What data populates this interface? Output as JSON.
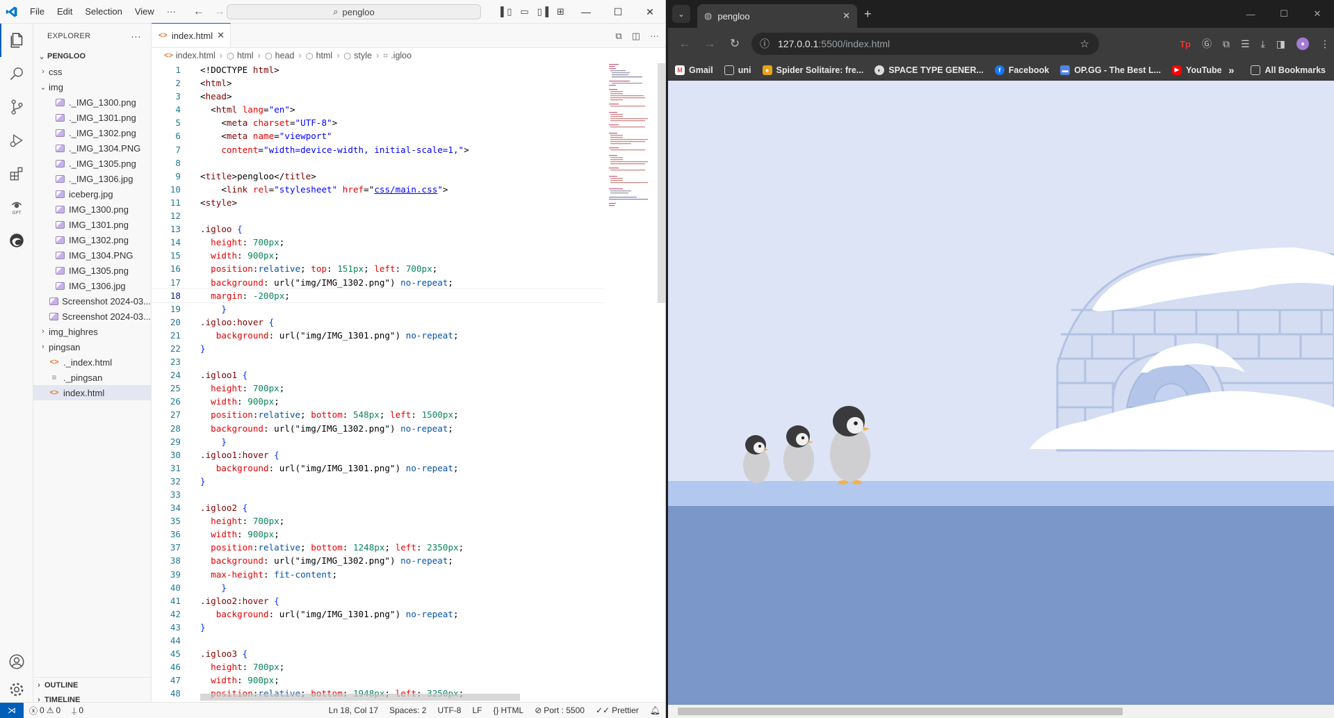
{
  "vscode": {
    "menu": [
      "File",
      "Edit",
      "Selection",
      "View",
      "···"
    ],
    "command_center": "pengloo",
    "explorer_title": "EXPLORER",
    "root_folder": "PENGLOO",
    "tree": [
      {
        "label": "css",
        "kind": "folder",
        "depth": 1,
        "open": false
      },
      {
        "label": "img",
        "kind": "folder",
        "depth": 1,
        "open": true
      },
      {
        "label": "._IMG_1300.png",
        "kind": "image",
        "depth": 2
      },
      {
        "label": "._IMG_1301.png",
        "kind": "image",
        "depth": 2
      },
      {
        "label": "._IMG_1302.png",
        "kind": "image",
        "depth": 2
      },
      {
        "label": "._IMG_1304.PNG",
        "kind": "image",
        "depth": 2
      },
      {
        "label": "._IMG_1305.png",
        "kind": "image",
        "depth": 2
      },
      {
        "label": "._IMG_1306.jpg",
        "kind": "image",
        "depth": 2
      },
      {
        "label": "iceberg.jpg",
        "kind": "image",
        "depth": 2
      },
      {
        "label": "IMG_1300.png",
        "kind": "image",
        "depth": 2
      },
      {
        "label": "IMG_1301.png",
        "kind": "image",
        "depth": 2
      },
      {
        "label": "IMG_1302.png",
        "kind": "image",
        "depth": 2
      },
      {
        "label": "IMG_1304.PNG",
        "kind": "image",
        "depth": 2
      },
      {
        "label": "IMG_1305.png",
        "kind": "image",
        "depth": 2
      },
      {
        "label": "IMG_1306.jpg",
        "kind": "image",
        "depth": 2
      },
      {
        "label": "Screenshot 2024-03...",
        "kind": "image",
        "depth": 2
      },
      {
        "label": "Screenshot 2024-03...",
        "kind": "image",
        "depth": 2
      },
      {
        "label": "img_highres",
        "kind": "folder",
        "depth": 1,
        "open": false
      },
      {
        "label": "pingsan",
        "kind": "folder",
        "depth": 1,
        "open": false
      },
      {
        "label": "._index.html",
        "kind": "html",
        "depth": 1
      },
      {
        "label": "._pingsan",
        "kind": "text",
        "depth": 1
      },
      {
        "label": "index.html",
        "kind": "html",
        "depth": 1,
        "selected": true
      }
    ],
    "outline_label": "OUTLINE",
    "timeline_label": "TIMELINE",
    "tab_label": "index.html",
    "breadcrumb": [
      "index.html",
      "html",
      "head",
      "html",
      "style",
      ".igloo"
    ],
    "current_line": 18,
    "code_lines": [
      [
        [
          "t-plain",
          "<!DOCTYPE "
        ],
        [
          "t-tag",
          "html"
        ],
        [
          "t-plain",
          ">"
        ]
      ],
      [
        [
          "t-plain",
          "<"
        ],
        [
          "t-tag",
          "html"
        ],
        [
          "t-plain",
          ">"
        ]
      ],
      [
        [
          "t-plain",
          "<"
        ],
        [
          "t-tag",
          "head"
        ],
        [
          "t-plain",
          ">"
        ]
      ],
      [
        [
          "t-plain",
          "  <"
        ],
        [
          "t-tag",
          "html"
        ],
        [
          "t-plain",
          " "
        ],
        [
          "t-attr",
          "lang"
        ],
        [
          "t-plain",
          "="
        ],
        [
          "t-str",
          "\"en\""
        ],
        [
          "t-plain",
          ">"
        ]
      ],
      [
        [
          "t-plain",
          "    <"
        ],
        [
          "t-tag",
          "meta"
        ],
        [
          "t-plain",
          " "
        ],
        [
          "t-attr",
          "charset"
        ],
        [
          "t-plain",
          "="
        ],
        [
          "t-str",
          "\"UTF-8\""
        ],
        [
          "t-plain",
          ">"
        ]
      ],
      [
        [
          "t-plain",
          "    <"
        ],
        [
          "t-tag",
          "meta"
        ],
        [
          "t-plain",
          " "
        ],
        [
          "t-attr",
          "name"
        ],
        [
          "t-plain",
          "="
        ],
        [
          "t-str",
          "\"viewport\""
        ]
      ],
      [
        [
          "t-plain",
          "    "
        ],
        [
          "t-attr",
          "content"
        ],
        [
          "t-plain",
          "="
        ],
        [
          "t-str",
          "\"width=device-width, initial-scale=1,\""
        ],
        [
          "t-plain",
          ">"
        ]
      ],
      [
        [
          "t-plain",
          ""
        ]
      ],
      [
        [
          "t-plain",
          "<"
        ],
        [
          "t-tag",
          "title"
        ],
        [
          "t-plain",
          ">pengloo</"
        ],
        [
          "t-tag",
          "title"
        ],
        [
          "t-plain",
          ">"
        ]
      ],
      [
        [
          "t-plain",
          "    <"
        ],
        [
          "t-tag",
          "link"
        ],
        [
          "t-plain",
          " "
        ],
        [
          "t-attr",
          "rel"
        ],
        [
          "t-plain",
          "="
        ],
        [
          "t-str",
          "\"stylesheet\""
        ],
        [
          "t-plain",
          " "
        ],
        [
          "t-attr",
          "href"
        ],
        [
          "t-plain",
          "=\""
        ],
        [
          "t-link",
          "css/main.css"
        ],
        [
          "t-str",
          "\""
        ],
        [
          "t-plain",
          ">"
        ]
      ],
      [
        [
          "t-plain",
          "<"
        ],
        [
          "t-tag",
          "style"
        ],
        [
          "t-plain",
          ">"
        ]
      ],
      [
        [
          "t-plain",
          ""
        ]
      ],
      [
        [
          "t-sel",
          ".igloo"
        ],
        [
          "t-plain",
          " "
        ],
        [
          "t-brace",
          "{"
        ]
      ],
      [
        [
          "t-plain",
          "  "
        ],
        [
          "t-prop",
          "height"
        ],
        [
          "t-plain",
          ": "
        ],
        [
          "t-num",
          "700px"
        ],
        [
          "t-plain",
          ";"
        ]
      ],
      [
        [
          "t-plain",
          "  "
        ],
        [
          "t-prop",
          "width"
        ],
        [
          "t-plain",
          ": "
        ],
        [
          "t-num",
          "900px"
        ],
        [
          "t-plain",
          ";"
        ]
      ],
      [
        [
          "t-plain",
          "  "
        ],
        [
          "t-prop",
          "position"
        ],
        [
          "t-plain",
          ":"
        ],
        [
          "t-val",
          "relative"
        ],
        [
          "t-plain",
          "; "
        ],
        [
          "t-prop",
          "top"
        ],
        [
          "t-plain",
          ": "
        ],
        [
          "t-num",
          "151px"
        ],
        [
          "t-plain",
          "; "
        ],
        [
          "t-prop",
          "left"
        ],
        [
          "t-plain",
          ": "
        ],
        [
          "t-num",
          "700px"
        ],
        [
          "t-plain",
          ";"
        ]
      ],
      [
        [
          "t-plain",
          "  "
        ],
        [
          "t-prop",
          "background"
        ],
        [
          "t-plain",
          ": url("
        ],
        [
          "t-plain",
          "\"img/IMG_1302.png\""
        ],
        [
          "t-plain",
          ") "
        ],
        [
          "t-val",
          "no-repeat"
        ],
        [
          "t-plain",
          ";"
        ]
      ],
      [
        [
          "t-plain",
          "  "
        ],
        [
          "t-prop",
          "margin"
        ],
        [
          "t-plain",
          ": "
        ],
        [
          "t-num",
          "-200px"
        ],
        [
          "t-plain",
          ";"
        ]
      ],
      [
        [
          "t-plain",
          "    "
        ],
        [
          "t-brace",
          "}"
        ]
      ],
      [
        [
          "t-sel",
          ".igloo:hover"
        ],
        [
          "t-plain",
          " "
        ],
        [
          "t-brace",
          "{"
        ]
      ],
      [
        [
          "t-plain",
          "   "
        ],
        [
          "t-prop",
          "background"
        ],
        [
          "t-plain",
          ": url("
        ],
        [
          "t-plain",
          "\"img/IMG_1301.png\""
        ],
        [
          "t-plain",
          ") "
        ],
        [
          "t-val",
          "no-repeat"
        ],
        [
          "t-plain",
          ";"
        ]
      ],
      [
        [
          "t-brace",
          "}"
        ]
      ],
      [
        [
          "t-plain",
          ""
        ]
      ],
      [
        [
          "t-sel",
          ".igloo1"
        ],
        [
          "t-plain",
          " "
        ],
        [
          "t-brace",
          "{"
        ]
      ],
      [
        [
          "t-plain",
          "  "
        ],
        [
          "t-prop",
          "height"
        ],
        [
          "t-plain",
          ": "
        ],
        [
          "t-num",
          "700px"
        ],
        [
          "t-plain",
          ";"
        ]
      ],
      [
        [
          "t-plain",
          "  "
        ],
        [
          "t-prop",
          "width"
        ],
        [
          "t-plain",
          ": "
        ],
        [
          "t-num",
          "900px"
        ],
        [
          "t-plain",
          ";"
        ]
      ],
      [
        [
          "t-plain",
          "  "
        ],
        [
          "t-prop",
          "position"
        ],
        [
          "t-plain",
          ":"
        ],
        [
          "t-val",
          "relative"
        ],
        [
          "t-plain",
          "; "
        ],
        [
          "t-prop",
          "bottom"
        ],
        [
          "t-plain",
          ": "
        ],
        [
          "t-num",
          "548px"
        ],
        [
          "t-plain",
          "; "
        ],
        [
          "t-prop",
          "left"
        ],
        [
          "t-plain",
          ": "
        ],
        [
          "t-num",
          "1500px"
        ],
        [
          "t-plain",
          ";"
        ]
      ],
      [
        [
          "t-plain",
          "  "
        ],
        [
          "t-prop",
          "background"
        ],
        [
          "t-plain",
          ": url("
        ],
        [
          "t-plain",
          "\"img/IMG_1302.png\""
        ],
        [
          "t-plain",
          ") "
        ],
        [
          "t-val",
          "no-repeat"
        ],
        [
          "t-plain",
          ";"
        ]
      ],
      [
        [
          "t-plain",
          "    "
        ],
        [
          "t-brace",
          "}"
        ]
      ],
      [
        [
          "t-sel",
          ".igloo1:hover"
        ],
        [
          "t-plain",
          " "
        ],
        [
          "t-brace",
          "{"
        ]
      ],
      [
        [
          "t-plain",
          "   "
        ],
        [
          "t-prop",
          "background"
        ],
        [
          "t-plain",
          ": url("
        ],
        [
          "t-plain",
          "\"img/IMG_1301.png\""
        ],
        [
          "t-plain",
          ") "
        ],
        [
          "t-val",
          "no-repeat"
        ],
        [
          "t-plain",
          ";"
        ]
      ],
      [
        [
          "t-brace",
          "}"
        ]
      ],
      [
        [
          "t-plain",
          ""
        ]
      ],
      [
        [
          "t-sel",
          ".igloo2"
        ],
        [
          "t-plain",
          " "
        ],
        [
          "t-brace",
          "{"
        ]
      ],
      [
        [
          "t-plain",
          "  "
        ],
        [
          "t-prop",
          "height"
        ],
        [
          "t-plain",
          ": "
        ],
        [
          "t-num",
          "700px"
        ],
        [
          "t-plain",
          ";"
        ]
      ],
      [
        [
          "t-plain",
          "  "
        ],
        [
          "t-prop",
          "width"
        ],
        [
          "t-plain",
          ": "
        ],
        [
          "t-num",
          "900px"
        ],
        [
          "t-plain",
          ";"
        ]
      ],
      [
        [
          "t-plain",
          "  "
        ],
        [
          "t-prop",
          "position"
        ],
        [
          "t-plain",
          ":"
        ],
        [
          "t-val",
          "relative"
        ],
        [
          "t-plain",
          "; "
        ],
        [
          "t-prop",
          "bottom"
        ],
        [
          "t-plain",
          ": "
        ],
        [
          "t-num",
          "1248px"
        ],
        [
          "t-plain",
          "; "
        ],
        [
          "t-prop",
          "left"
        ],
        [
          "t-plain",
          ": "
        ],
        [
          "t-num",
          "2350px"
        ],
        [
          "t-plain",
          ";"
        ]
      ],
      [
        [
          "t-plain",
          "  "
        ],
        [
          "t-prop",
          "background"
        ],
        [
          "t-plain",
          ": url("
        ],
        [
          "t-plain",
          "\"img/IMG_1302.png\""
        ],
        [
          "t-plain",
          ") "
        ],
        [
          "t-val",
          "no-repeat"
        ],
        [
          "t-plain",
          ";"
        ]
      ],
      [
        [
          "t-plain",
          "  "
        ],
        [
          "t-prop",
          "max-height"
        ],
        [
          "t-plain",
          ": "
        ],
        [
          "t-val",
          "fit-content"
        ],
        [
          "t-plain",
          ";"
        ]
      ],
      [
        [
          "t-plain",
          "    "
        ],
        [
          "t-brace",
          "}"
        ]
      ],
      [
        [
          "t-sel",
          ".igloo2:hover"
        ],
        [
          "t-plain",
          " "
        ],
        [
          "t-brace",
          "{"
        ]
      ],
      [
        [
          "t-plain",
          "   "
        ],
        [
          "t-prop",
          "background"
        ],
        [
          "t-plain",
          ": url("
        ],
        [
          "t-plain",
          "\"img/IMG_1301.png\""
        ],
        [
          "t-plain",
          ") "
        ],
        [
          "t-val",
          "no-repeat"
        ],
        [
          "t-plain",
          ";"
        ]
      ],
      [
        [
          "t-brace",
          "}"
        ]
      ],
      [
        [
          "t-plain",
          ""
        ]
      ],
      [
        [
          "t-sel",
          ".igloo3"
        ],
        [
          "t-plain",
          " "
        ],
        [
          "t-brace",
          "{"
        ]
      ],
      [
        [
          "t-plain",
          "  "
        ],
        [
          "t-prop",
          "height"
        ],
        [
          "t-plain",
          ": "
        ],
        [
          "t-num",
          "700px"
        ],
        [
          "t-plain",
          ";"
        ]
      ],
      [
        [
          "t-plain",
          "  "
        ],
        [
          "t-prop",
          "width"
        ],
        [
          "t-plain",
          ": "
        ],
        [
          "t-num",
          "900px"
        ],
        [
          "t-plain",
          ";"
        ]
      ],
      [
        [
          "t-plain",
          "  "
        ],
        [
          "t-prop",
          "position"
        ],
        [
          "t-plain",
          ":"
        ],
        [
          "t-val",
          "relative"
        ],
        [
          "t-plain",
          "; "
        ],
        [
          "t-prop",
          "bottom"
        ],
        [
          "t-plain",
          ": "
        ],
        [
          "t-num",
          "1948px"
        ],
        [
          "t-plain",
          "; "
        ],
        [
          "t-prop",
          "left"
        ],
        [
          "t-plain",
          ": "
        ],
        [
          "t-num",
          "3250px"
        ],
        [
          "t-plain",
          ";"
        ]
      ]
    ],
    "status": {
      "errors": "0",
      "warnings": "0",
      "ports": "0",
      "cursor": "Ln 18, Col 17",
      "spaces": "Spaces: 2",
      "encoding": "UTF-8",
      "eol": "LF",
      "language": "HTML",
      "port": "Port : 5500",
      "formatter": "Prettier"
    }
  },
  "chrome": {
    "tab_title": "pengloo",
    "url_host": "127.0.0.1",
    "url_rest": ":5500/index.html",
    "bookmarks": [
      "Gmail",
      "uni",
      "Spider Solitaire: fre...",
      "SPACE TYPE GENER...",
      "Facebook",
      "OP.GG - The Best L...",
      "YouTube"
    ],
    "all_bookmarks": "All Bookmarks",
    "colors": {
      "sky": "#dde4f6",
      "ice_light": "#b3c8ef",
      "ice_dark": "#7b96c9",
      "igloo_lines": "#b8c6e6",
      "snow": "#ffffff",
      "penguin_body": "#cfcfd1",
      "penguin_head": "#3a3a3c",
      "beak": "#f2b24a"
    }
  }
}
